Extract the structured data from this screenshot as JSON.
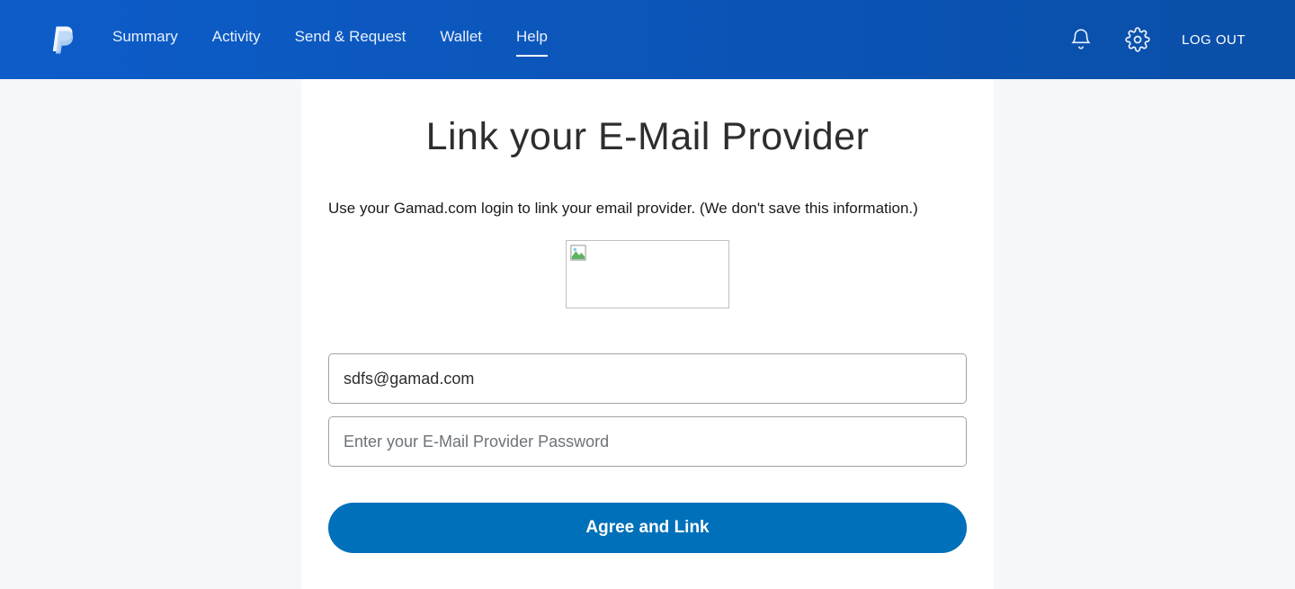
{
  "header": {
    "nav": {
      "summary": "Summary",
      "activity": "Activity",
      "send_request": "Send & Request",
      "wallet": "Wallet",
      "help": "Help"
    },
    "logout": "LOG OUT"
  },
  "main": {
    "title": "Link your E-Mail Provider",
    "subtitle": "Use your Gamad.com login to link your email provider. (We don't save this information.)",
    "email_value": "sdfs@gamad.com",
    "password_placeholder": "Enter your E-Mail Provider Password",
    "submit_label": "Agree and Link"
  }
}
